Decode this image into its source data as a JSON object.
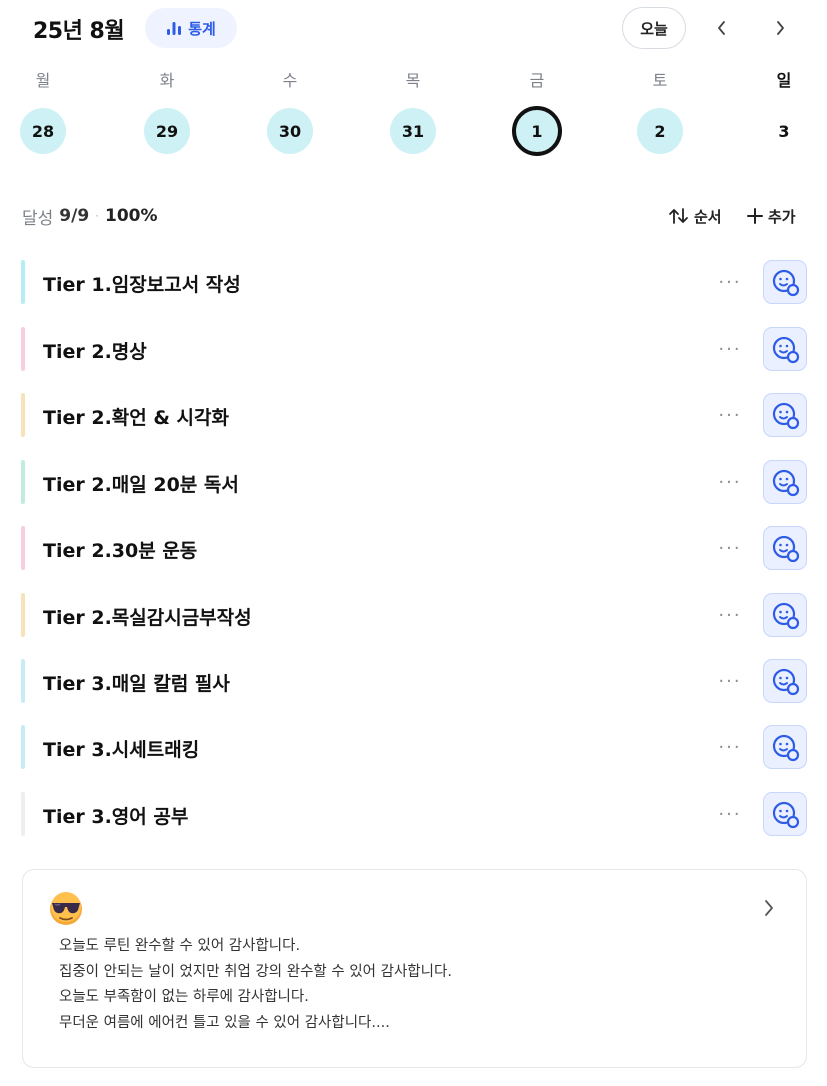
{
  "header": {
    "month_title": "25년 8월",
    "stats_label": "통계",
    "today_label": "오늘"
  },
  "week": {
    "days": [
      {
        "name": "월",
        "date": "28",
        "state": "completed"
      },
      {
        "name": "화",
        "date": "29",
        "state": "completed"
      },
      {
        "name": "수",
        "date": "30",
        "state": "completed"
      },
      {
        "name": "목",
        "date": "31",
        "state": "completed"
      },
      {
        "name": "금",
        "date": "1",
        "state": "selected"
      },
      {
        "name": "토",
        "date": "2",
        "state": "completed"
      },
      {
        "name": "일",
        "date": "3",
        "state": "none"
      }
    ]
  },
  "summary": {
    "label": "달성",
    "count": "9/9",
    "separator": "·",
    "percent": "100%",
    "order_label": "순서",
    "add_label": "추가"
  },
  "routines": [
    {
      "title": "Tier 1.임장보고서 작성",
      "color": "#b6ecf3"
    },
    {
      "title": "Tier 2.명상",
      "color": "#f9cde0"
    },
    {
      "title": "Tier 2.확언 & 시각화",
      "color": "#f9e2b8"
    },
    {
      "title": "Tier 2.매일 20분 독서",
      "color": "#bfeedd"
    },
    {
      "title": "Tier 2.30분 운동",
      "color": "#f9cde0"
    },
    {
      "title": "Tier 2.목실감시금부작성",
      "color": "#f9e2b8"
    },
    {
      "title": "Tier 3.매일 칼럼 필사",
      "color": "#c8ecf6"
    },
    {
      "title": "Tier 3.시세트래킹",
      "color": "#c8ecf6"
    },
    {
      "title": "Tier 3.영어 공부",
      "color": "#eceef0"
    }
  ],
  "gratitude": {
    "emoji": "cool-sunglasses-emoji",
    "lines": [
      "오늘도 루틴 완수할 수 있어 감사합니다.",
      "집중이 안되는 날이 었지만 취업 강의 완수할 수 있어 감사합니다.",
      "오늘도 부족함이 없는 하루에 감사합니다.",
      "무더운 여름에 에어컨 틀고 있을 수 있어 감사합니다...."
    ]
  },
  "colors": {
    "accent_blue": "#2e5ce6",
    "day_completed": "#cdf1f5",
    "emoji_button_bg": "#eaf0ff"
  }
}
